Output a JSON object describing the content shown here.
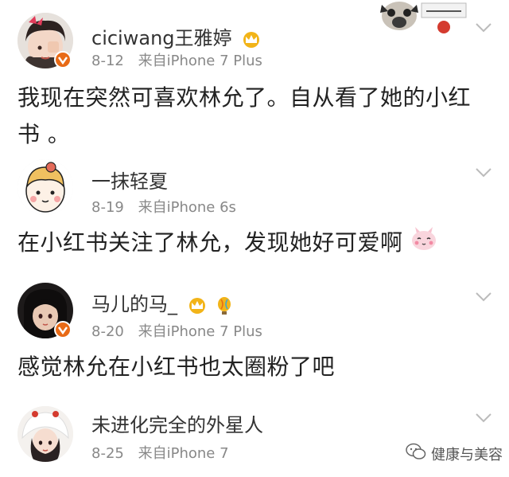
{
  "comments": [
    {
      "username": "ciciwang王雅婷",
      "date": "8-12",
      "source": "来自iPhone 7 Plus",
      "text_lines": [
        "我现在突然可喜欢林允了。自从看了她的小红",
        "书 。"
      ],
      "avatar_icon": "girl-covering-eye-avatar",
      "badge_icons": [
        "crown-icon"
      ]
    },
    {
      "username": "一抹轻夏",
      "date": "8-19",
      "source": "来自iPhone 6s",
      "text_lines": [
        "在小红书关注了林允，发现她好可爱啊"
      ],
      "avatar_icon": "cartoon-girl-avatar",
      "badge_icons": [],
      "trailing_emoji": "bunny-face-emoji"
    },
    {
      "username": "马儿的马_",
      "date": "8-20",
      "source": "来自iPhone 7 Plus",
      "text_lines": [
        "感觉林允在小红书也太圈粉了吧"
      ],
      "avatar_icon": "dark-hair-girl-avatar",
      "badge_icons": [
        "crown-icon",
        "balloon-icon"
      ]
    },
    {
      "username": "未进化完全的外星人",
      "date": "8-25",
      "source": "来自iPhone 7",
      "text_lines": [],
      "avatar_icon": "girl-with-hat-avatar",
      "badge_icons": []
    }
  ],
  "watermark": {
    "label": "健康与美容",
    "icon": "wechat-icon"
  },
  "sticker": {
    "icon": "pug-sticker"
  },
  "colors": {
    "text": "#222222",
    "meta": "#888888",
    "vip": "#e86a16",
    "crown": "#f2b418"
  }
}
